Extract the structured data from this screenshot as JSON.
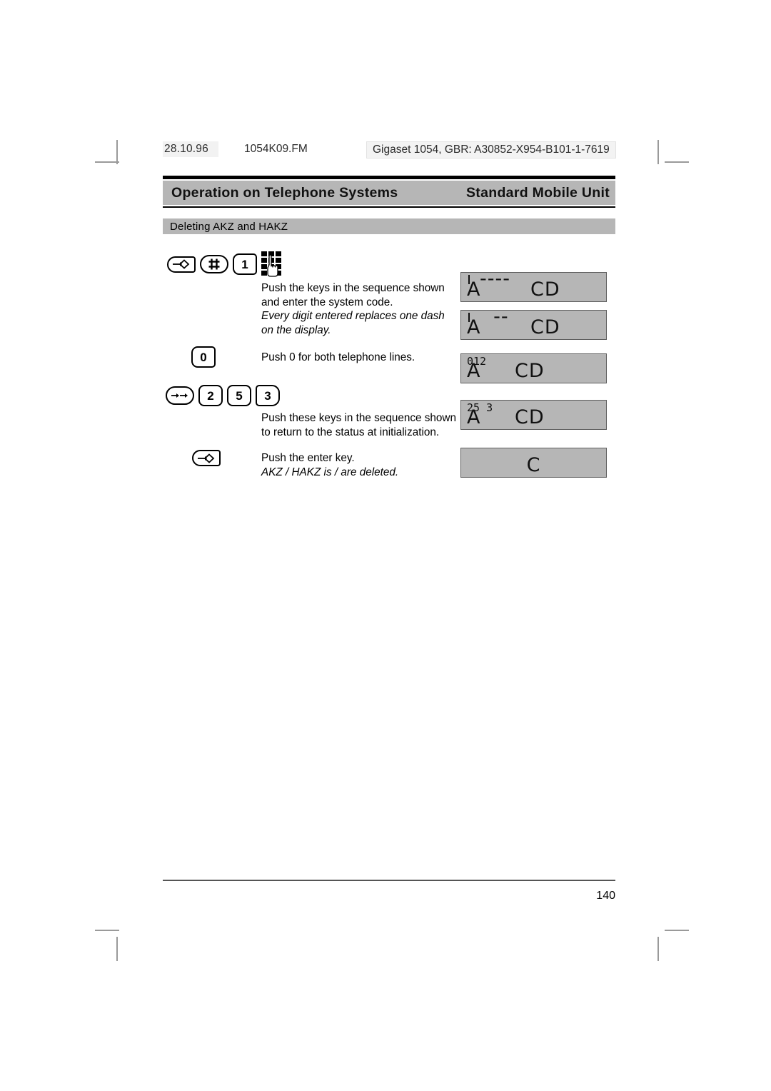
{
  "print_info": {
    "date": "28.10.96",
    "filename": "1054K09.FM",
    "identifier": "Gigaset 1054, GBR: A30852-X954-B101-1-7619"
  },
  "header": {
    "left_title": "Operation on Telephone Systems",
    "right_title": "Standard Mobile Unit"
  },
  "section": {
    "title": "Deleting AKZ and HAKZ"
  },
  "steps": [
    {
      "keys": [
        {
          "icon": "enter-key-icon",
          "label": ""
        },
        {
          "icon": "hash-key-icon",
          "label": "#"
        },
        {
          "icon": "digit-key-icon",
          "label": "1"
        },
        {
          "icon": "keypad-hand-icon",
          "label": ""
        }
      ],
      "text_lines": [
        "Push the keys in the sequence shown",
        "and enter the system code."
      ],
      "italic_lines": [
        "Every digit entered replaces one dash",
        "on the display."
      ]
    },
    {
      "keys": [
        {
          "icon": "digit-key-icon",
          "label": "0"
        }
      ],
      "text_lines": [
        "Push 0 for both telephone lines."
      ],
      "italic_lines": []
    },
    {
      "keys": [
        {
          "icon": "forward-key-icon",
          "label": ""
        },
        {
          "icon": "digit-key-icon",
          "label": "2"
        },
        {
          "icon": "digit-key-icon",
          "label": "5"
        },
        {
          "icon": "digit-key-icon",
          "label": "3"
        }
      ],
      "text_lines": [
        "Push these keys in the sequence shown",
        "to return to the status at initialization."
      ],
      "italic_lines": []
    },
    {
      "keys": [
        {
          "icon": "enter-key-icon",
          "label": ""
        }
      ],
      "text_lines": [
        "Push the enter key."
      ],
      "italic_lines": [
        "AKZ / HAKZ is / are deleted."
      ]
    }
  ],
  "displays": [
    {
      "small": "",
      "cursor": true,
      "main": "A",
      "dashes": "----",
      "suffix": "CD",
      "align": "left"
    },
    {
      "small": "",
      "cursor": true,
      "main": "A",
      "dashes": "  --",
      "suffix": "CD",
      "align": "left"
    },
    {
      "small": "012",
      "cursor": false,
      "main": "A",
      "dashes": "",
      "suffix": "CD",
      "align": "left"
    },
    {
      "small": "25 3",
      "cursor": false,
      "main": "A",
      "dashes": "",
      "suffix": "CD",
      "align": "left"
    },
    {
      "small": "",
      "cursor": false,
      "main": "C",
      "dashes": "",
      "suffix": "",
      "align": "center"
    }
  ],
  "footer": {
    "page_number": "140"
  },
  "colors": {
    "band_gray": "#b6b6b6",
    "lcd_gray": "#b6b6b6",
    "lcd_border": "#5d5d5d",
    "rule_black": "#000000"
  }
}
